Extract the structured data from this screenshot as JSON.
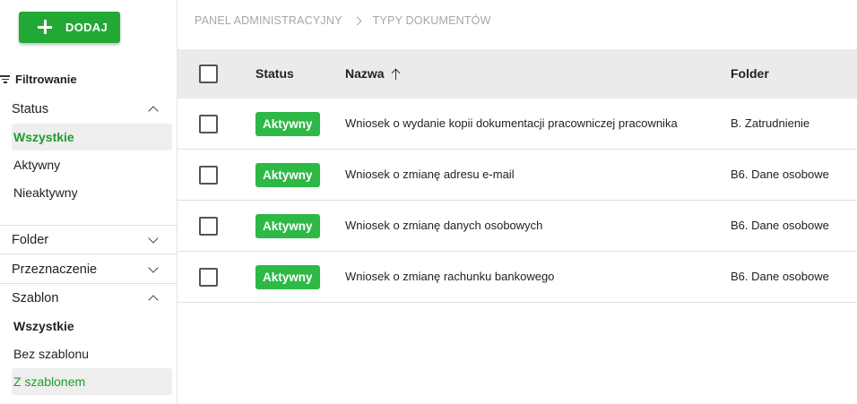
{
  "toolbar": {
    "add_label": "DODAJ"
  },
  "filters": {
    "title": "Filtrowanie",
    "status": {
      "label": "Status",
      "options": [
        "Wszystkie",
        "Aktywny",
        "Nieaktywny"
      ]
    },
    "folder": {
      "label": "Folder"
    },
    "przeznaczenie": {
      "label": "Przeznaczenie"
    },
    "szablon": {
      "label": "Szablon",
      "options": [
        "Wszystkie",
        "Bez szablonu",
        "Z szablonem"
      ]
    }
  },
  "breadcrumb": [
    "PANEL ADMINISTRACYJNY",
    "TYPY DOKUMENTÓW"
  ],
  "table": {
    "headers": {
      "status": "Status",
      "name": "Nazwa",
      "folder": "Folder"
    },
    "rows": [
      {
        "status": "Aktywny",
        "name": "Wniosek o wydanie kopii dokumentacji pracowniczej pracownika",
        "folder": "B. Zatrudnienie"
      },
      {
        "status": "Aktywny",
        "name": "Wniosek o zmianę adresu e-mail",
        "folder": "B6. Dane osobowe"
      },
      {
        "status": "Aktywny",
        "name": "Wniosek o zmianę danych osobowych",
        "folder": "B6. Dane osobowe"
      },
      {
        "status": "Aktywny",
        "name": "Wniosek o zmianę rachunku bankowego",
        "folder": "B6. Dane osobowe"
      }
    ]
  },
  "colors": {
    "accent": "#22a935",
    "badge": "#2eb846",
    "selected_text": "#1e9c2e"
  },
  "icons": [
    "plus-icon",
    "filter-icon",
    "chevron-up-icon",
    "chevron-down-icon",
    "chevron-right-icon",
    "sort-arrow-up-icon"
  ]
}
